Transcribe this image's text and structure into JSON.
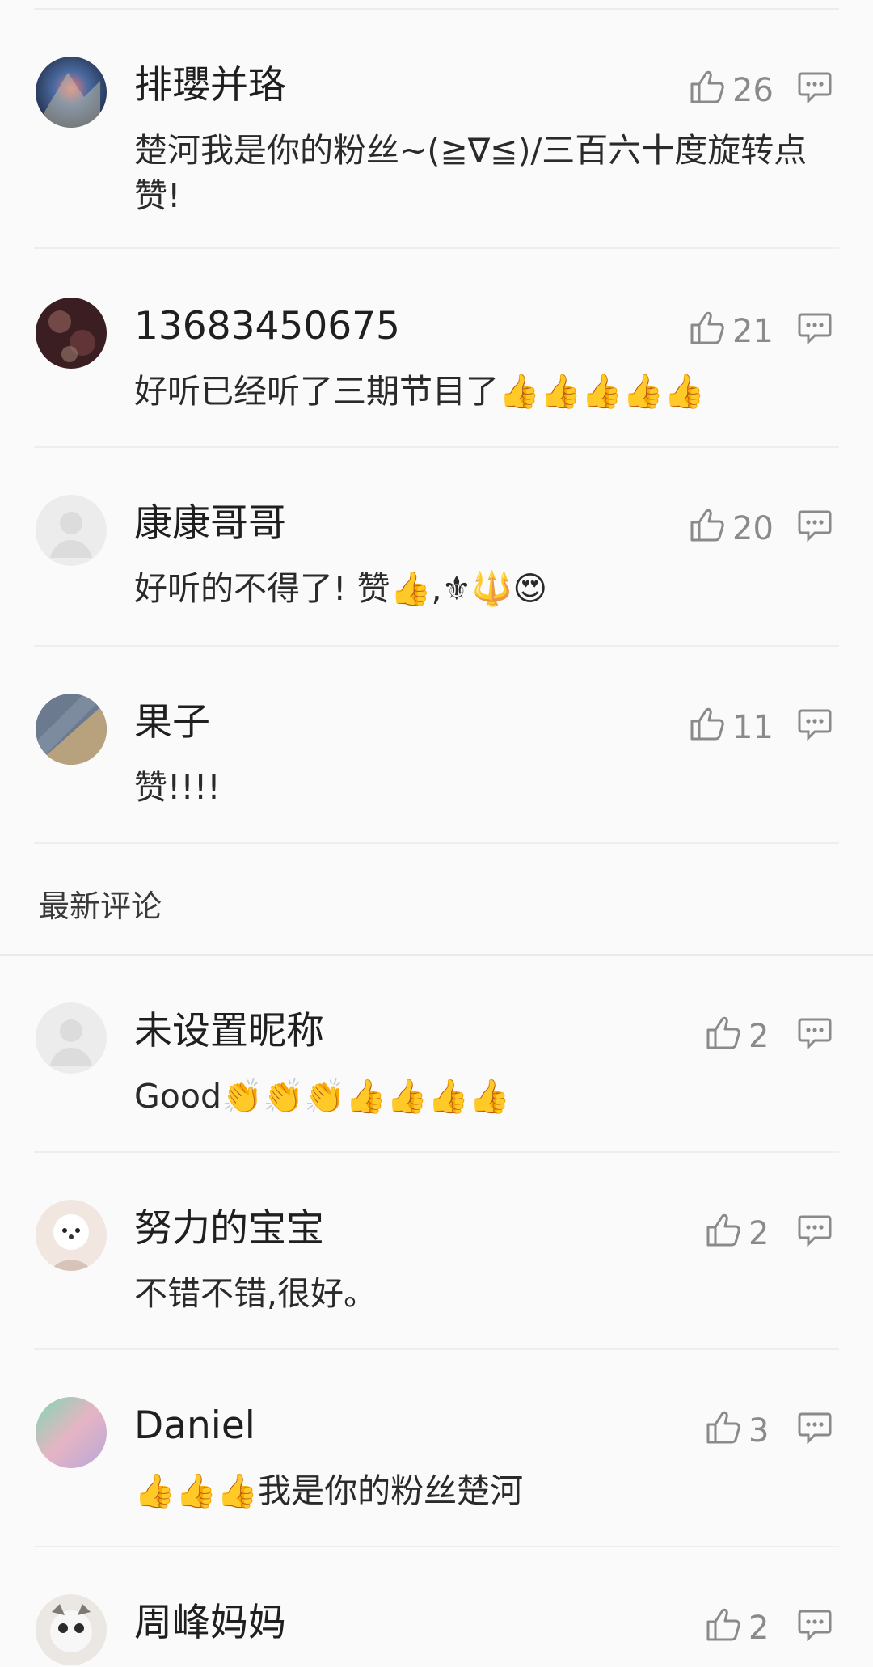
{
  "section_title": "最新评论",
  "comments": [
    {
      "name": "排瓔并珞",
      "text": "楚河我是你的粉丝~(≧∇≦)/三百六十度旋转点赞!",
      "likes": "26"
    },
    {
      "name": "13683450675",
      "text": "好听已经听了三期节目了👍👍👍👍👍",
      "likes": "21"
    },
    {
      "name": "康康哥哥",
      "text": "好听的不得了! 赞👍,⚜🔱😍",
      "likes": "20"
    },
    {
      "name": "果子",
      "text": "赞!!!!",
      "likes": "11"
    },
    {
      "name": "未设置昵称",
      "text": "Good👏👏👏👍👍👍👍",
      "likes": "2"
    },
    {
      "name": "努力的宝宝",
      "text": "不错不错,很好。",
      "likes": "2"
    },
    {
      "name": "Daniel",
      "text": "👍👍👍我是你的粉丝楚河",
      "likes": "3"
    },
    {
      "name": "周峰妈妈",
      "text": "",
      "likes": "2"
    }
  ],
  "icons": {
    "like": "thumbs-up-outline-icon",
    "reply": "comment-bubble-icon"
  }
}
